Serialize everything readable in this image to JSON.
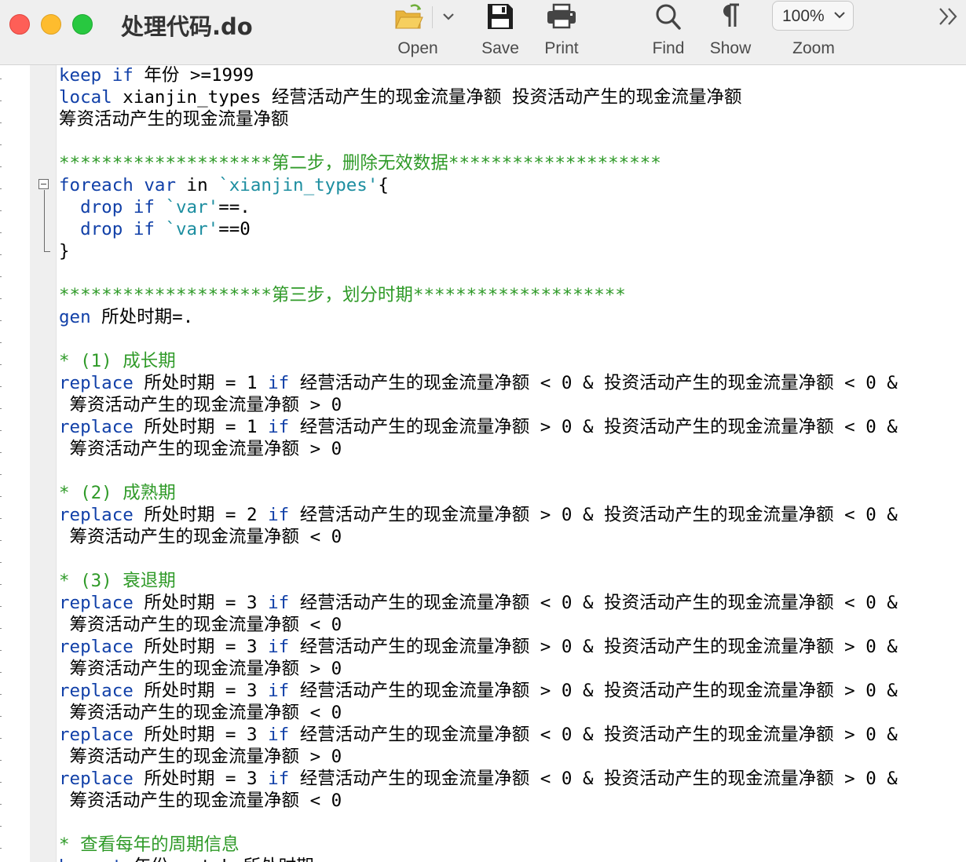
{
  "window": {
    "title": "处理代码.do"
  },
  "toolbar": {
    "open_label": "Open",
    "save_label": "Save",
    "print_label": "Print",
    "find_label": "Find",
    "show_label": "Show",
    "zoom_label": "Zoom",
    "zoom_value": "100%"
  },
  "colors": {
    "keyword": "#1140a8",
    "local_macro": "#1d8ea0",
    "comment": "#2f9a28",
    "plain": "#000000",
    "gutter": "#efefef"
  },
  "editor": {
    "lines": [
      [
        {
          "t": "k",
          "v": "keep"
        },
        {
          "t": "p",
          "v": " "
        },
        {
          "t": "k",
          "v": "if"
        },
        {
          "t": "p",
          "v": " 年份 >=1999"
        }
      ],
      [
        {
          "t": "k",
          "v": "local"
        },
        {
          "t": "p",
          "v": " xianjin_types 经营活动产生的现金流量净额 投资活动产生的现金流量净额"
        }
      ],
      [
        {
          "t": "p",
          "v": "筹资活动产生的现金流量净额"
        }
      ],
      [],
      [
        {
          "t": "c",
          "v": "********************第二步，删除无效数据********************"
        }
      ],
      [
        {
          "t": "k",
          "v": "foreach"
        },
        {
          "t": "p",
          "v": " "
        },
        {
          "t": "k",
          "v": "var"
        },
        {
          "t": "p",
          "v": " in "
        },
        {
          "t": "s",
          "v": "`xianjin_types'"
        },
        {
          "t": "p",
          "v": "{"
        }
      ],
      [
        {
          "t": "p",
          "v": "  "
        },
        {
          "t": "k",
          "v": "drop"
        },
        {
          "t": "p",
          "v": " "
        },
        {
          "t": "k",
          "v": "if"
        },
        {
          "t": "p",
          "v": " "
        },
        {
          "t": "s",
          "v": "`var'"
        },
        {
          "t": "p",
          "v": "==."
        }
      ],
      [
        {
          "t": "p",
          "v": "  "
        },
        {
          "t": "k",
          "v": "drop"
        },
        {
          "t": "p",
          "v": " "
        },
        {
          "t": "k",
          "v": "if"
        },
        {
          "t": "p",
          "v": " "
        },
        {
          "t": "s",
          "v": "`var'"
        },
        {
          "t": "p",
          "v": "==0"
        }
      ],
      [
        {
          "t": "p",
          "v": "}"
        }
      ],
      [],
      [
        {
          "t": "c",
          "v": "********************第三步，划分时期********************"
        }
      ],
      [
        {
          "t": "k",
          "v": "gen"
        },
        {
          "t": "p",
          "v": " 所处时期=."
        }
      ],
      [],
      [
        {
          "t": "c",
          "v": "* (1) 成长期"
        }
      ],
      [
        {
          "t": "k",
          "v": "replace"
        },
        {
          "t": "p",
          "v": " 所处时期 = 1 "
        },
        {
          "t": "k",
          "v": "if"
        },
        {
          "t": "p",
          "v": " 经营活动产生的现金流量净额 < 0 & 投资活动产生的现金流量净额 < 0 &"
        }
      ],
      [
        {
          "t": "p",
          "v": " 筹资活动产生的现金流量净额 > 0"
        }
      ],
      [
        {
          "t": "k",
          "v": "replace"
        },
        {
          "t": "p",
          "v": " 所处时期 = 1 "
        },
        {
          "t": "k",
          "v": "if"
        },
        {
          "t": "p",
          "v": " 经营活动产生的现金流量净额 > 0 & 投资活动产生的现金流量净额 < 0 &"
        }
      ],
      [
        {
          "t": "p",
          "v": " 筹资活动产生的现金流量净额 > 0"
        }
      ],
      [],
      [
        {
          "t": "c",
          "v": "* (2) 成熟期"
        }
      ],
      [
        {
          "t": "k",
          "v": "replace"
        },
        {
          "t": "p",
          "v": " 所处时期 = 2 "
        },
        {
          "t": "k",
          "v": "if"
        },
        {
          "t": "p",
          "v": " 经营活动产生的现金流量净额 > 0 & 投资活动产生的现金流量净额 < 0 &"
        }
      ],
      [
        {
          "t": "p",
          "v": " 筹资活动产生的现金流量净额 < 0"
        }
      ],
      [],
      [
        {
          "t": "c",
          "v": "* (3) 衰退期"
        }
      ],
      [
        {
          "t": "k",
          "v": "replace"
        },
        {
          "t": "p",
          "v": " 所处时期 = 3 "
        },
        {
          "t": "k",
          "v": "if"
        },
        {
          "t": "p",
          "v": " 经营活动产生的现金流量净额 < 0 & 投资活动产生的现金流量净额 < 0 &"
        }
      ],
      [
        {
          "t": "p",
          "v": " 筹资活动产生的现金流量净额 < 0"
        }
      ],
      [
        {
          "t": "k",
          "v": "replace"
        },
        {
          "t": "p",
          "v": " 所处时期 = 3 "
        },
        {
          "t": "k",
          "v": "if"
        },
        {
          "t": "p",
          "v": " 经营活动产生的现金流量净额 > 0 & 投资活动产生的现金流量净额 > 0 &"
        }
      ],
      [
        {
          "t": "p",
          "v": " 筹资活动产生的现金流量净额 > 0"
        }
      ],
      [
        {
          "t": "k",
          "v": "replace"
        },
        {
          "t": "p",
          "v": " 所处时期 = 3 "
        },
        {
          "t": "k",
          "v": "if"
        },
        {
          "t": "p",
          "v": " 经营活动产生的现金流量净额 > 0 & 投资活动产生的现金流量净额 > 0 &"
        }
      ],
      [
        {
          "t": "p",
          "v": " 筹资活动产生的现金流量净额 < 0"
        }
      ],
      [
        {
          "t": "k",
          "v": "replace"
        },
        {
          "t": "p",
          "v": " 所处时期 = 3 "
        },
        {
          "t": "k",
          "v": "if"
        },
        {
          "t": "p",
          "v": " 经营活动产生的现金流量净额 < 0 & 投资活动产生的现金流量净额 > 0 &"
        }
      ],
      [
        {
          "t": "p",
          "v": " 筹资活动产生的现金流量净额 > 0"
        }
      ],
      [
        {
          "t": "k",
          "v": "replace"
        },
        {
          "t": "p",
          "v": " 所处时期 = 3 "
        },
        {
          "t": "k",
          "v": "if"
        },
        {
          "t": "p",
          "v": " 经营活动产生的现金流量净额 < 0 & 投资活动产生的现金流量净额 > 0 &"
        }
      ],
      [
        {
          "t": "p",
          "v": " 筹资活动产生的现金流量净额 < 0"
        }
      ],
      [],
      [
        {
          "t": "c",
          "v": "* 查看每年的周期信息"
        }
      ],
      [
        {
          "t": "k",
          "v": "bysort"
        },
        {
          "t": "p",
          "v": " 年份 : tab 所处时期"
        }
      ]
    ]
  }
}
